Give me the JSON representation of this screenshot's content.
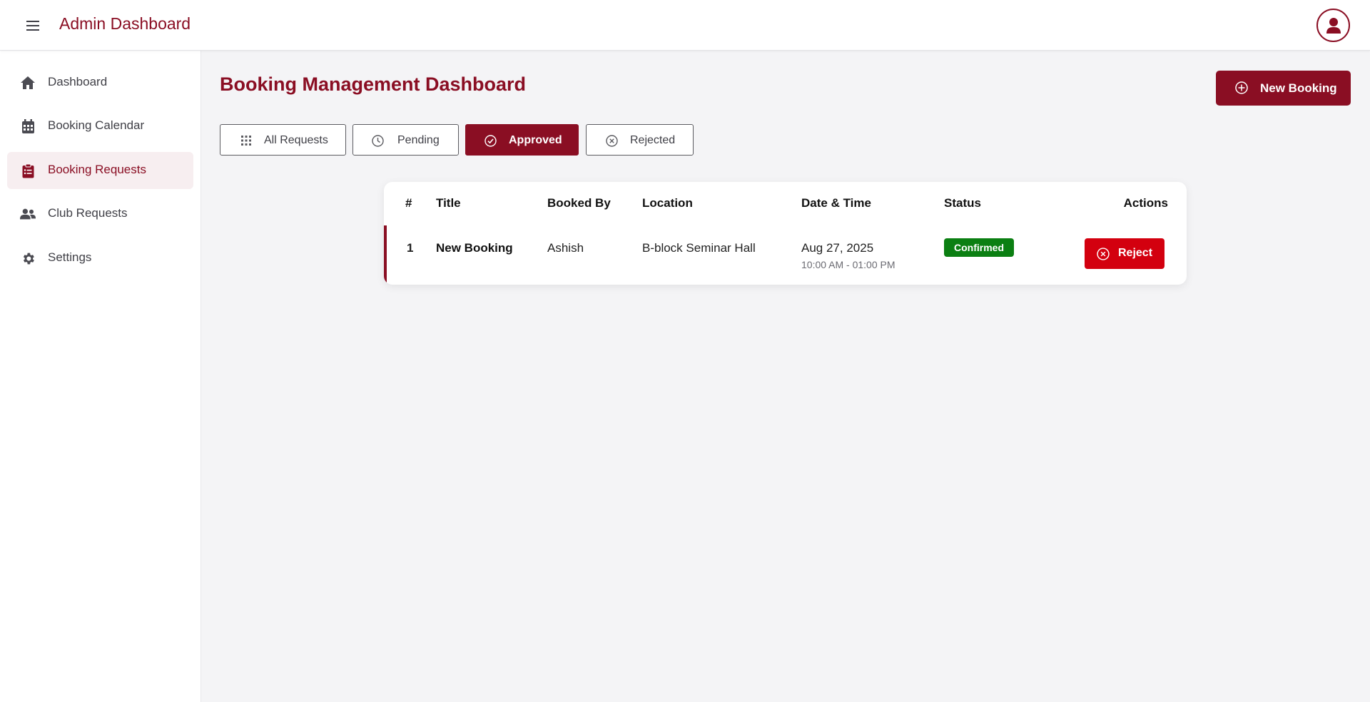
{
  "app": {
    "title": "Admin Dashboard",
    "brand_color": "#8a0e23"
  },
  "sidebar": {
    "items": [
      {
        "label": "Dashboard",
        "icon": "home-icon",
        "active": false
      },
      {
        "label": "Booking Calendar",
        "icon": "calendar-icon",
        "active": false
      },
      {
        "label": "Booking Requests",
        "icon": "clipboard-list-icon",
        "active": true
      },
      {
        "label": "Club Requests",
        "icon": "users-icon",
        "active": false
      },
      {
        "label": "Settings",
        "icon": "gear-icon",
        "active": false
      }
    ]
  },
  "main": {
    "title": "Booking Management Dashboard",
    "new_booking_label": "New Booking",
    "filters": [
      {
        "label": "All Requests",
        "icon": "grid-icon",
        "active": false
      },
      {
        "label": "Pending",
        "icon": "clock-icon",
        "active": false
      },
      {
        "label": "Approved",
        "icon": "check-circle-icon",
        "active": true
      },
      {
        "label": "Rejected",
        "icon": "x-circle-icon",
        "active": false
      }
    ]
  },
  "table": {
    "headers": [
      "#",
      "Title",
      "Booked By",
      "Location",
      "Date & Time",
      "Status",
      "Actions"
    ],
    "rows": [
      {
        "index": "1",
        "title": "New Booking",
        "booked_by": "Ashish",
        "location": "B-block Seminar Hall",
        "date": "Aug 27, 2025",
        "time": "10:00 AM - 01:00 PM",
        "status": "Confirmed",
        "action_label": "Reject"
      }
    ],
    "status_color": "#0b7f12",
    "reject_color": "#d3000f"
  }
}
